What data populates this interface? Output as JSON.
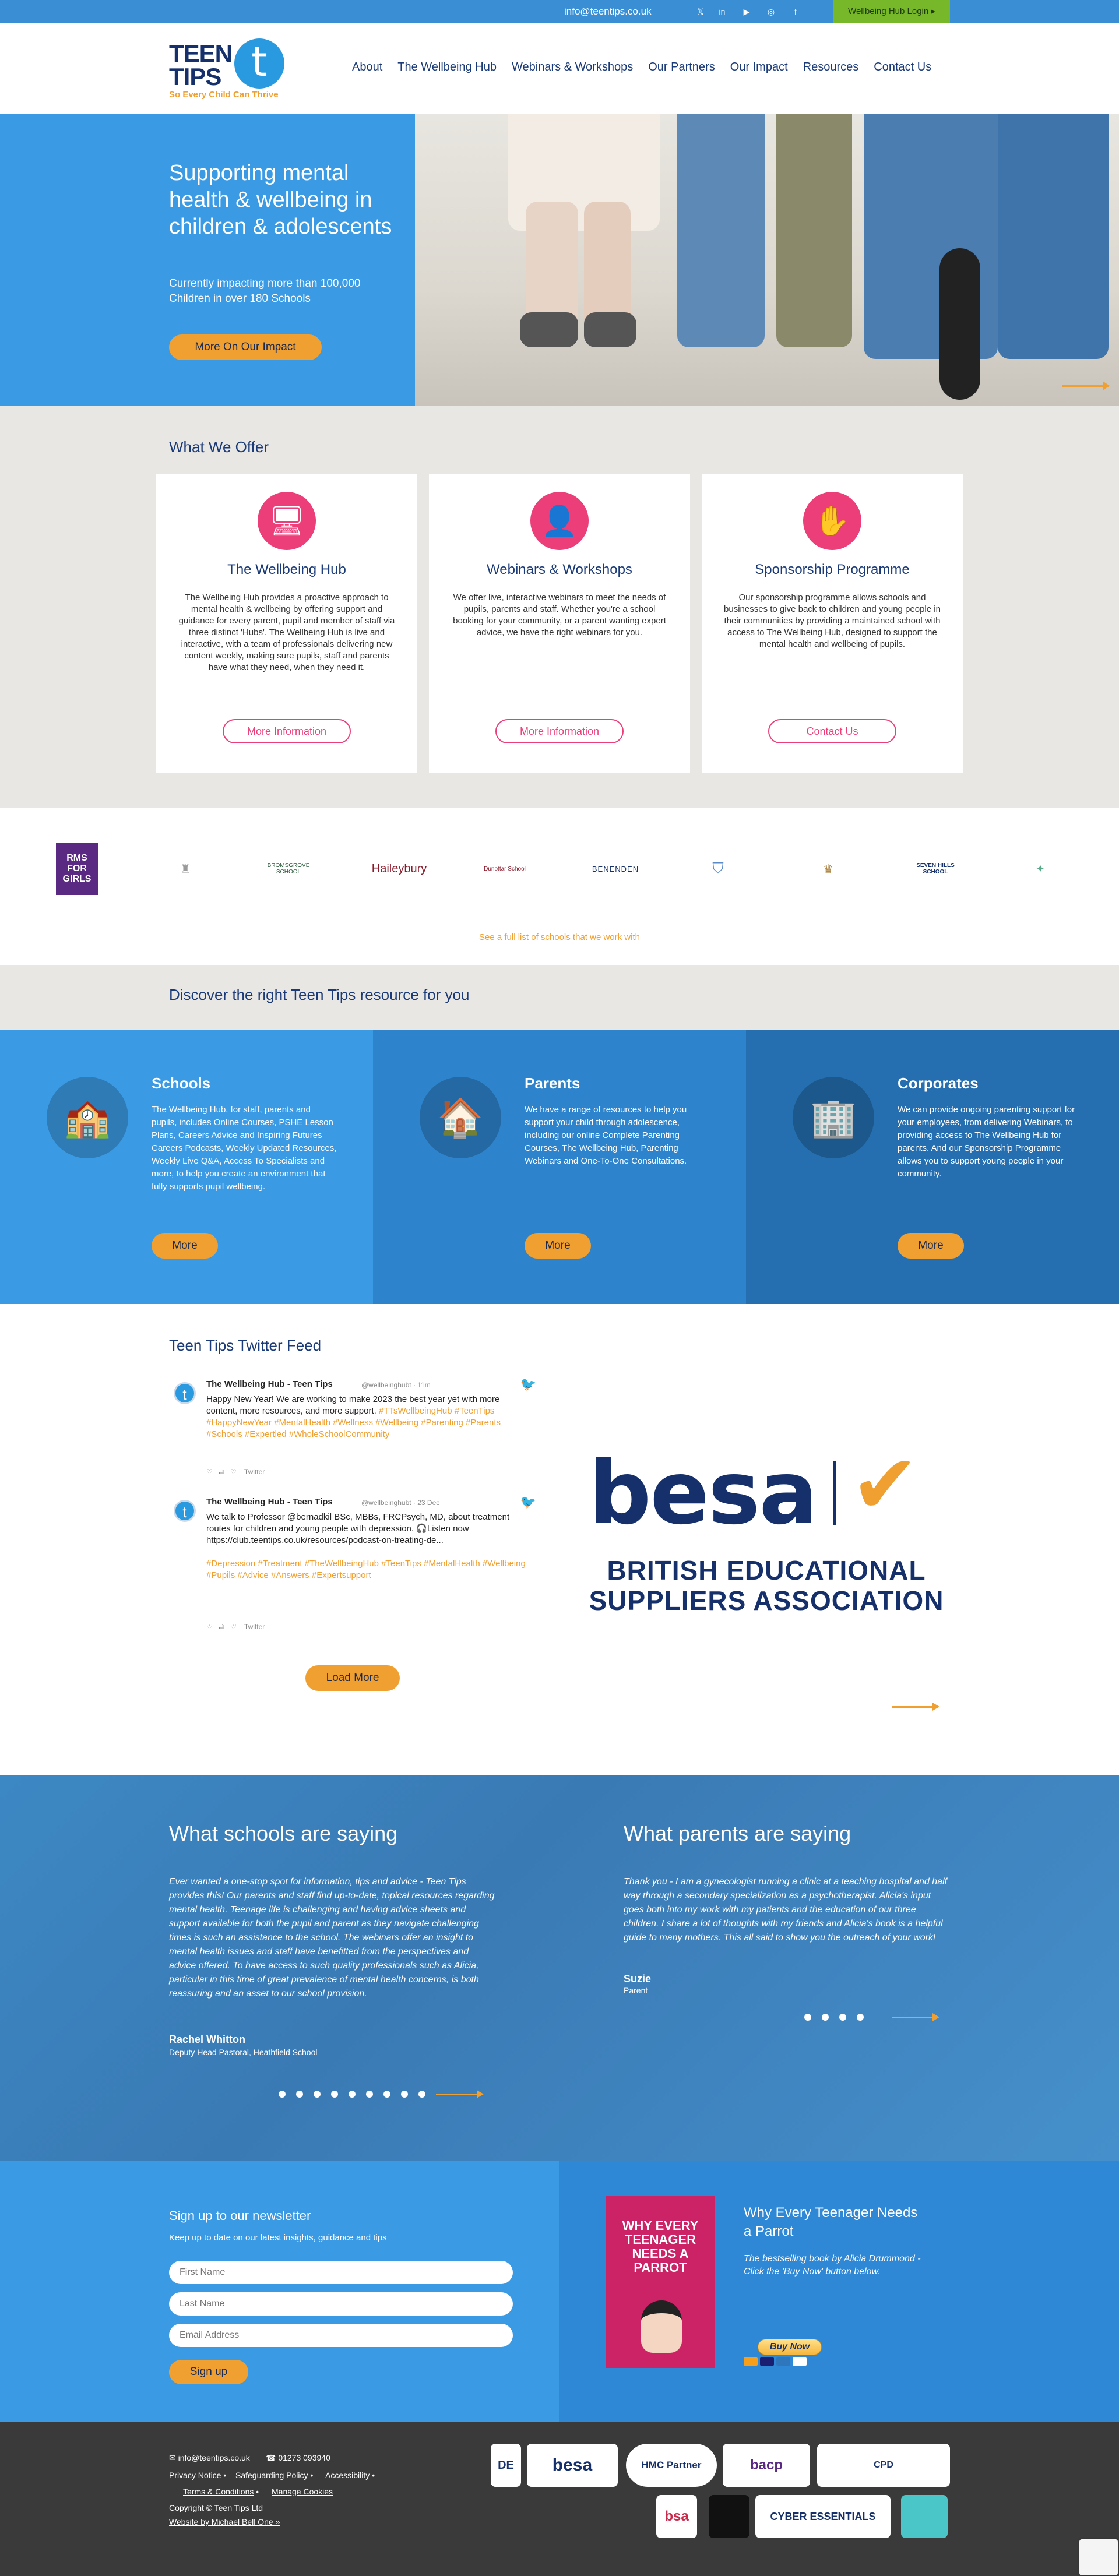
{
  "topbar": {
    "email": "info@teentips.co.uk",
    "social": [
      "twitter-icon",
      "linkedin-icon",
      "youtube-icon",
      "instagram-icon",
      "facebook-icon"
    ],
    "login": "Wellbeing Hub Login ▸"
  },
  "header": {
    "logo_text": "TEEN TIPS",
    "logo_letter": "t",
    "tagline": "So Every Child Can Thrive",
    "nav": [
      "About",
      "The Wellbeing Hub",
      "Webinars & Workshops",
      "Our Partners",
      "Our Impact",
      "Resources",
      "Contact Us"
    ]
  },
  "hero": {
    "title": "Supporting mental health & wellbeing in children & adolescents",
    "subtitle": "Currently impacting more than 100,000 Children in over 180 Schools",
    "button": "More On Our Impact"
  },
  "offer": {
    "heading": "What We Offer",
    "cards": [
      {
        "icon": "monitor-icon",
        "glyph": "🖥",
        "title": "The Wellbeing Hub",
        "text": "The Wellbeing Hub provides a proactive approach to mental health & wellbeing by offering support and guidance for every parent, pupil and member of staff via three distinct 'Hubs'. The Wellbeing Hub is live and interactive, with a team of professionals delivering new content weekly, making sure pupils, staff and parents have what they need, when they need it.",
        "button": "More Information"
      },
      {
        "icon": "presentation-icon",
        "glyph": "👤",
        "title": "Webinars & Workshops",
        "text": "We offer live, interactive webinars to meet the needs of pupils, parents and staff. Whether you're a school booking for your community, or a parent wanting expert advice, we have the right webinars for you.",
        "button": "More Information"
      },
      {
        "icon": "hand-icon",
        "glyph": "✋",
        "title": "Sponsorship Programme",
        "text": "Our sponsorship programme allows schools and businesses to give back to children and young people in their communities by providing a maintained school with access to The Wellbeing Hub, designed to support the mental health and wellbeing of pupils.",
        "button": "Contact Us"
      }
    ]
  },
  "schools": {
    "logos": [
      "RMS FOR GIRLS",
      "",
      "BROMSGROVE SCHOOL",
      "Haileybury",
      "Dunottar School",
      "",
      "BENENDEN",
      "",
      "",
      "",
      "SEVEN HILLS SCHOOL",
      ""
    ],
    "see_all": "See a full list of schools that we work with"
  },
  "discover": {
    "heading": "Discover the right Teen Tips resource for you"
  },
  "resources": [
    {
      "icon": "school-building-icon",
      "glyph": "🏫",
      "title": "Schools",
      "text": "The Wellbeing Hub, for staff, parents and pupils, includes Online Courses, PSHE Lesson Plans, Careers Advice and Inspiring Futures Careers Podcasts, Weekly Updated Resources, Weekly Live Q&A, Access To Specialists and more, to help you create an environment that fully supports pupil wellbeing.",
      "button": "More",
      "color": "#3a9ae4"
    },
    {
      "icon": "house-icon",
      "glyph": "🏠",
      "title": "Parents",
      "text": "We have a range of resources to help you support your child through adolescence, including our online Complete Parenting Courses, The Wellbeing Hub, Parenting Webinars and One-To-One Consultations.",
      "button": "More",
      "color": "#2e84cc"
    },
    {
      "icon": "office-building-icon",
      "glyph": "🏢",
      "title": "Corporates",
      "text": "We can provide ongoing parenting support for your employees, from delivering Webinars, to providing access to The Wellbeing Hub for parents. And our Sponsorship Programme allows you to support young people in your community.",
      "button": "More",
      "color": "#256fb0"
    }
  ],
  "twitter": {
    "heading": "Teen Tips Twitter Feed",
    "tweets": [
      {
        "name": "The Wellbeing Hub - Teen Tips",
        "handle": "@wellbeinghubt · 11m",
        "text": "Happy New Year! We are working to make 2023 the best year yet with more content, more resources, and more support. ",
        "tags": "#TTsWellbeingHub #TeenTips #HappyNewYear #MentalHealth #Wellness #Wellbeing #Parenting #Parents #Schools #Expertled #WholeSchoolCommunity",
        "source": "Twitter"
      },
      {
        "name": "The Wellbeing Hub - Teen Tips",
        "handle": "@wellbeinghubt · 23 Dec",
        "text": "We talk to Professor @bernadkil BSc, MBBs, FRCPsych, MD, about treatment routes for children and young people with depression. 🎧Listen now https://club.teentips.co.uk/resources/podcast-on-treating-de...",
        "tags": "#Depression #Treatment #TheWellbeingHub #TeenTips #MentalHealth #Wellbeing #Pupils #Advice #Answers #Expertsupport",
        "source": "Twitter"
      }
    ],
    "load_more": "Load More"
  },
  "besa": {
    "mark": "besa",
    "line1": "BRITISH EDUCATIONAL",
    "line2": "SUPPLIERS ASSOCIATION"
  },
  "testimonials": {
    "schools_heading": "What schools are saying",
    "schools_quote": "Ever wanted a one-stop spot for information, tips and advice - Teen Tips provides this! Our parents and staff find up-to-date, topical resources regarding mental health. Teenage life is challenging and having advice sheets and support available for both the pupil and parent as they navigate challenging times is such an assistance to the school. The webinars offer an insight to mental health issues and staff have benefitted from the perspectives and advice offered. To have access to such quality professionals such as Alicia, particular in this time of great prevalence of mental health concerns, is both reassuring and an asset to our school provision.",
    "schools_name": "Rachel Whitton",
    "schools_role": "Deputy Head Pastoral, Heathfield School",
    "parents_heading": "What parents are saying",
    "parents_quote": "Thank you - I am a gynecologist running a clinic at a teaching hospital and half way through a secondary specialization as a psychotherapist. Alicia's input goes both into my work with my patients and the education of our three children. I share a lot of thoughts with my friends and Alicia's book is a helpful guide to many mothers. This all said to show you the outreach of your work!",
    "parents_name": "Suzie",
    "parents_role": "Parent"
  },
  "newsletter": {
    "heading": "Sign up to our newsletter",
    "sub": "Keep up to date on our latest insights, guidance and tips",
    "first": "First Name",
    "last": "Last Name",
    "email": "Email Address",
    "button": "Sign up"
  },
  "book": {
    "cover_title": "WHY EVERY TEENAGER NEEDS A PARROT",
    "heading": "Why Every Teenager Needs a Parrot",
    "text": "The bestselling book by Alicia Drummond - Click the 'Buy Now' button below.",
    "buy": "Buy Now"
  },
  "footer": {
    "email": "✉ info@teentips.co.uk",
    "phone": "☎ 01273 093940",
    "privacy": "Privacy Notice",
    "safeguarding": "Safeguarding Policy",
    "accessibility": "Accessibility",
    "terms": "Terms & Conditions",
    "cookies": "Manage Cookies",
    "copyright": "Copyright © Teen Tips Ltd",
    "credit": "Website by Michael Bell One »",
    "badges": [
      "DE",
      "besa",
      "HMC Partner",
      "bacp",
      "CPD",
      "bsa",
      "",
      "CYBER ESSENTIALS",
      ""
    ]
  },
  "colors": {
    "primary": "#3a9ae4",
    "navy": "#15306b",
    "accent": "#f0a030",
    "pink": "#ec3e78",
    "green": "#76b82a"
  }
}
